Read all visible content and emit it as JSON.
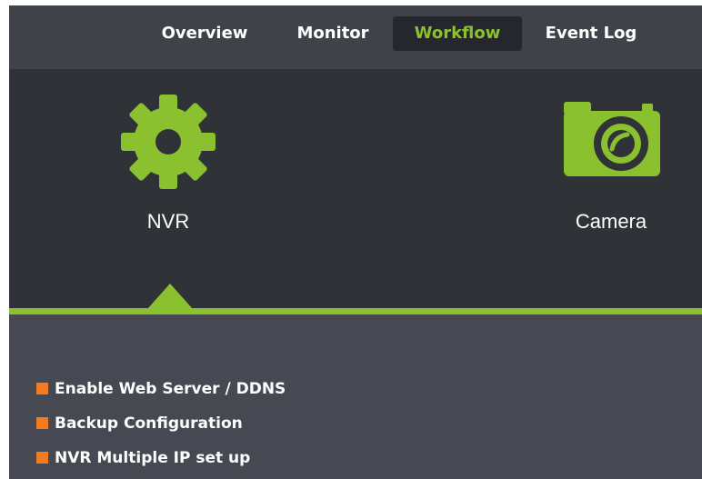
{
  "nav": {
    "tabs": [
      {
        "label": "Overview",
        "active": false
      },
      {
        "label": "Monitor",
        "active": false
      },
      {
        "label": "Workflow",
        "active": true
      },
      {
        "label": "Event Log",
        "active": false
      }
    ]
  },
  "hero": {
    "items": [
      {
        "label": "NVR",
        "icon": "gear-icon",
        "selected": true
      },
      {
        "label": "Camera",
        "icon": "camera-icon",
        "selected": false
      }
    ]
  },
  "links": [
    {
      "label": "Enable Web Server / DDNS"
    },
    {
      "label": "Backup Configuration"
    },
    {
      "label": "NVR Multiple IP set up"
    }
  ],
  "colors": {
    "accent": "#8bc12f",
    "bullet": "#f47b20",
    "nav_bg": "#3f4249",
    "hero_bg": "#2f3237",
    "panel_bg": "#464951"
  }
}
